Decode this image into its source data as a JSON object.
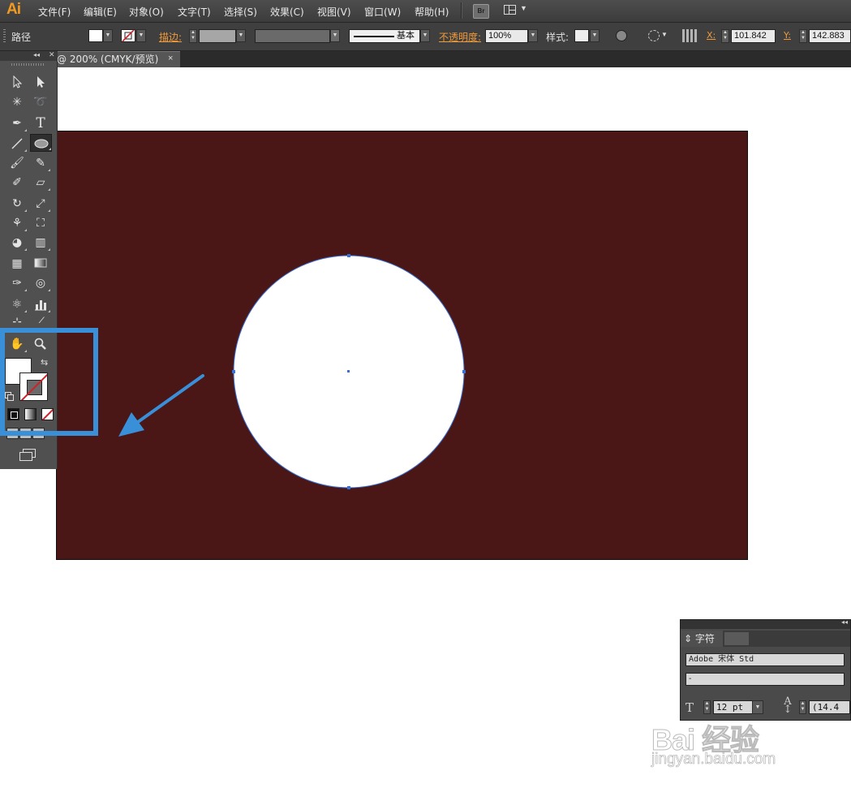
{
  "app": {
    "logo": "Ai",
    "menu": [
      "文件(F)",
      "编辑(E)",
      "对象(O)",
      "文字(T)",
      "选择(S)",
      "效果(C)",
      "视图(V)",
      "窗口(W)",
      "帮助(H)"
    ],
    "bridge_button": "Br"
  },
  "control_bar": {
    "selection_type": "路径",
    "stroke_label": "描边:",
    "stroke_profile": "基本",
    "opacity_label": "不透明度:",
    "opacity_value": "100%",
    "style_label": "样式:",
    "x_label": "X:",
    "x_value": "101.842",
    "y_label": "Y:",
    "y_value": "142.883"
  },
  "document": {
    "tab_title": "@ 200% (CMYK/预览)",
    "close": "×"
  },
  "canvas": {
    "background_color": "#4a1616",
    "circle_fill": "#ffffff",
    "selection_color": "#3b6fd1"
  },
  "tools": {
    "icons": [
      "selection-tool",
      "direct-selection-tool",
      "magic-wand-tool",
      "lasso-tool",
      "pen-tool",
      "type-tool",
      "line-tool",
      "ellipse-tool",
      "paintbrush-tool",
      "pencil-tool",
      "blob-brush-tool",
      "eraser-tool",
      "rotate-tool",
      "scale-tool",
      "width-tool",
      "free-transform-tool",
      "shape-builder-tool",
      "perspective-grid-tool",
      "mesh-tool",
      "gradient-tool",
      "eyedropper-tool",
      "blend-tool",
      "symbol-sprayer-tool",
      "column-graph-tool",
      "artboard-tool",
      "slice-tool",
      "hand-tool",
      "zoom-tool"
    ],
    "type_glyph": "T",
    "selected_tool": "ellipse-tool"
  },
  "annotation": {
    "highlight_color": "#3a8fd9"
  },
  "character_panel": {
    "tab_label": "字符",
    "font_family": "Adobe 宋体 Std",
    "font_style": "-",
    "size_icon": "T",
    "font_size": "12 pt",
    "leading_icon": "A",
    "leading_value": "(14.4"
  },
  "watermark": {
    "brand": "Bai 经验",
    "url": "jingyan.baidu.com"
  }
}
